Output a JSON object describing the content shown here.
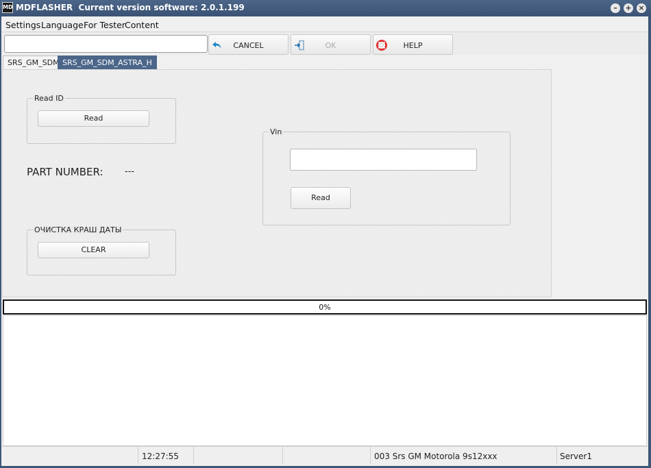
{
  "window": {
    "icon_text": "MD",
    "title": "MDFLASHER  Current version software: 2.0.1.199",
    "controls": [
      "minimize",
      "maximize",
      "close"
    ]
  },
  "menu": [
    "Settings",
    "Language",
    "For Tester",
    "Content"
  ],
  "toolbar": {
    "search": {
      "value": "",
      "placeholder": ""
    },
    "cancel": {
      "label": "CANCEL",
      "icon": "undo-arrow-icon",
      "enabled": true
    },
    "ok": {
      "label": "OK",
      "icon": "enter-door-icon",
      "enabled": false
    },
    "help": {
      "label": "HELP",
      "icon": "lifebuoy-icon",
      "enabled": true
    }
  },
  "tabs": [
    {
      "label": "SRS_GM_SDM",
      "active": false
    },
    {
      "label": "SRS_GM_SDM_ASTRA_H",
      "active": true
    }
  ],
  "panel": {
    "read_id": {
      "title": "Read ID",
      "button": "Read"
    },
    "part_number": {
      "label": "PART NUMBER:",
      "value": "---"
    },
    "crash_clear": {
      "title": "ОЧИСТКА КРАШ ДАТЫ",
      "button": "CLEAR"
    },
    "vin": {
      "title": "Vin",
      "value": "",
      "button": "Read"
    }
  },
  "progress": {
    "text": "0%",
    "value": 0
  },
  "log": {
    "text": ""
  },
  "status": {
    "cells": [
      "",
      "12:27:55",
      "",
      "",
      "003 Srs GM Motorola 9s12xxx",
      "Server1"
    ]
  },
  "colors": {
    "title_bar": "#3e5677",
    "active_tab": "#4b6689",
    "progress_fill": "#5b9bd5"
  }
}
